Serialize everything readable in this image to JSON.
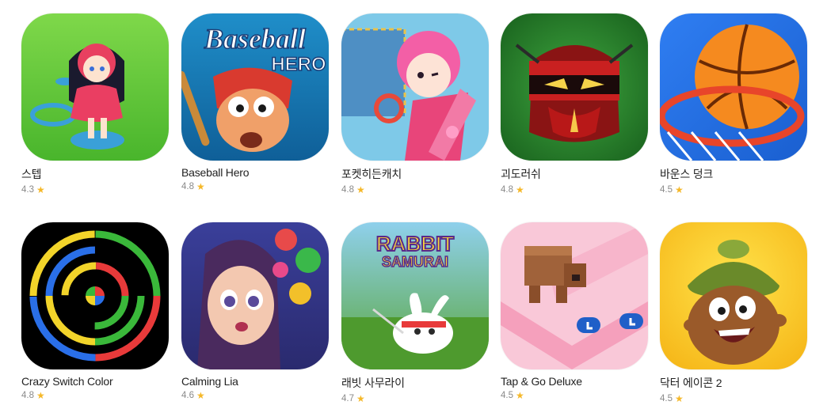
{
  "apps": [
    {
      "title": "스텝",
      "rating": "4.3",
      "icon": "step-game-icon"
    },
    {
      "title": "Baseball Hero",
      "rating": "4.8",
      "icon": "baseball-hero-icon",
      "art_text": [
        "Baseball",
        "HERO"
      ]
    },
    {
      "title": "포켓히든캐치",
      "rating": "4.8",
      "icon": "pocket-hidden-catch-icon"
    },
    {
      "title": "괴도러쉬",
      "rating": "4.8",
      "icon": "goedo-rush-icon"
    },
    {
      "title": "바운스 덩크",
      "rating": "4.5",
      "icon": "bounce-dunk-icon"
    },
    {
      "title": "Crazy Switch Color",
      "rating": "4.8",
      "icon": "crazy-switch-color-icon"
    },
    {
      "title": "Calming Lia",
      "rating": "4.6",
      "icon": "calming-lia-icon"
    },
    {
      "title": "래빗 사무라이",
      "rating": "4.7",
      "icon": "rabbit-samurai-icon",
      "art_text": [
        "RABBIT",
        "SAMURAI"
      ]
    },
    {
      "title": "Tap & Go Deluxe",
      "rating": "4.5",
      "icon": "tap-and-go-deluxe-icon"
    },
    {
      "title": "닥터 에이콘 2",
      "rating": "4.5",
      "icon": "doctor-acorn-2-icon"
    }
  ],
  "star_glyph": "★",
  "colors": {
    "star": "#f5b829",
    "title": "#222222",
    "rating": "#8a8a8a"
  }
}
